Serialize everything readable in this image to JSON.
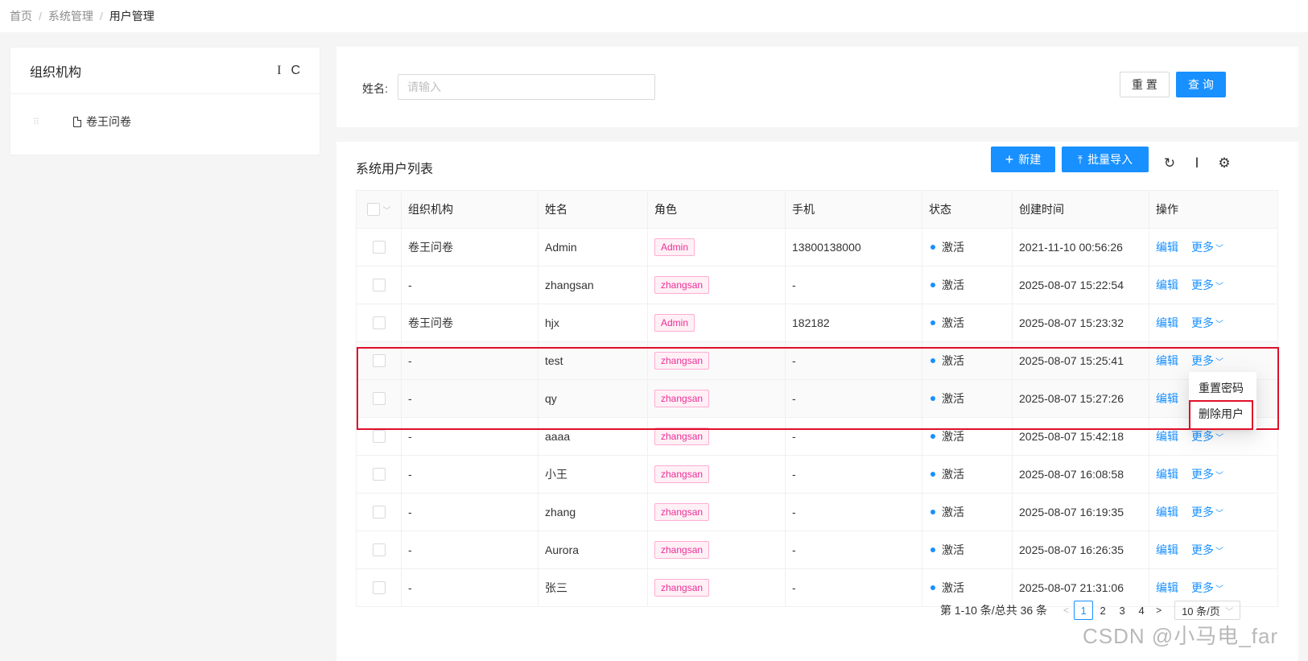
{
  "breadcrumb": [
    "首页",
    "系统管理",
    "用户管理"
  ],
  "breadcrumb_sep": "/",
  "org_panel": {
    "title": "组织机构",
    "tool_icons": [
      "text-cursor-icon",
      "refresh-icon"
    ],
    "tool_glyphs": [
      "I",
      "C"
    ],
    "tree": [
      {
        "label": "卷王问卷",
        "icon": "file-icon"
      }
    ]
  },
  "search": {
    "label": "姓名:",
    "placeholder": "请输入",
    "value": "",
    "reset_label": "重 置",
    "query_label": "查 询"
  },
  "table_panel": {
    "title": "系统用户列表",
    "new_label": "新建",
    "import_label": "批量导入",
    "icons": [
      "refresh-icon",
      "column-height-icon",
      "settings-icon"
    ]
  },
  "table": {
    "headers": [
      "组织机构",
      "姓名",
      "角色",
      "手机",
      "状态",
      "创建时间",
      "操作"
    ],
    "rows": [
      {
        "org": "卷王问卷",
        "name": "Admin",
        "role": "Admin",
        "phone": "13800138000",
        "status": "激活",
        "created": "2021-11-10 00:56:26",
        "edit": "编辑",
        "more": "更多"
      },
      {
        "org": "-",
        "name": "zhangsan",
        "role": "zhangsan",
        "phone": "-",
        "status": "激活",
        "created": "2025-08-07 15:22:54",
        "edit": "编辑",
        "more": "更多"
      },
      {
        "org": "卷王问卷",
        "name": "hjx",
        "role": "Admin",
        "phone": "182182",
        "status": "激活",
        "created": "2025-08-07 15:23:32",
        "edit": "编辑",
        "more": "更多"
      },
      {
        "org": "-",
        "name": "test",
        "role": "zhangsan",
        "phone": "-",
        "status": "激活",
        "created": "2025-08-07 15:25:41",
        "edit": "编辑",
        "more": "更多"
      },
      {
        "org": "-",
        "name": "qy",
        "role": "zhangsan",
        "phone": "-",
        "status": "激活",
        "created": "2025-08-07 15:27:26",
        "edit": "编辑",
        "more": ""
      },
      {
        "org": "-",
        "name": "aaaa",
        "role": "zhangsan",
        "phone": "-",
        "status": "激活",
        "created": "2025-08-07 15:42:18",
        "edit": "编辑",
        "more": "更多"
      },
      {
        "org": "-",
        "name": "小王",
        "role": "zhangsan",
        "phone": "-",
        "status": "激活",
        "created": "2025-08-07 16:08:58",
        "edit": "编辑",
        "more": "更多"
      },
      {
        "org": "-",
        "name": "zhang",
        "role": "zhangsan",
        "phone": "-",
        "status": "激活",
        "created": "2025-08-07 16:19:35",
        "edit": "编辑",
        "more": "更多"
      },
      {
        "org": "-",
        "name": "Aurora",
        "role": "zhangsan",
        "phone": "-",
        "status": "激活",
        "created": "2025-08-07 16:26:35",
        "edit": "编辑",
        "more": "更多"
      },
      {
        "org": "-",
        "name": "张三",
        "role": "zhangsan",
        "phone": "-",
        "status": "激活",
        "created": "2025-08-07 21:31:06",
        "edit": "编辑",
        "more": "更多"
      }
    ]
  },
  "dropdown": {
    "items": [
      "重置密码",
      "删除用户"
    ]
  },
  "pagination": {
    "total_text": "第 1-10 条/总共 36 条",
    "pages": [
      "1",
      "2",
      "3",
      "4"
    ],
    "current": "1",
    "page_size": "10 条/页"
  },
  "watermark": "CSDN @小马电_far",
  "colors": {
    "primary": "#1890ff",
    "tag": "#eb2f96",
    "annotation": "#e0102a"
  }
}
